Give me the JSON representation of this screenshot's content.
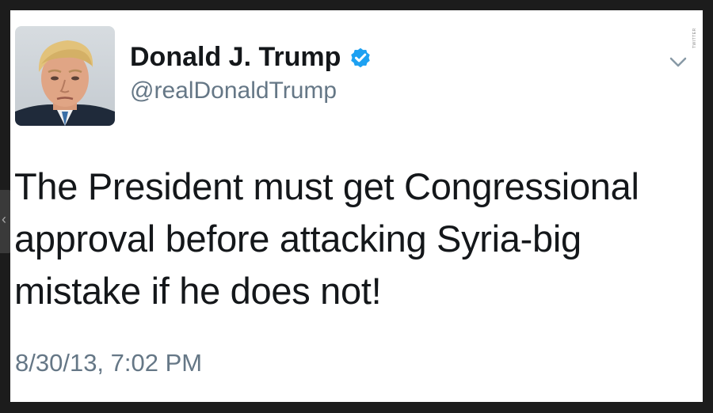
{
  "tweet": {
    "author_name": "Donald J. Trump",
    "handle": "@realDonaldTrump",
    "text": "The President must get Congressional approval before attacking Syria-big mistake if he does not!",
    "timestamp": "8/30/13, 7:02 PM",
    "verified_icon": "verified-badge-icon",
    "menu_icon": "chevron-down-icon"
  },
  "watermark": {
    "text": "TWITTER"
  },
  "side_nav": {
    "icon": "chevron-left-icon",
    "glyph": "‹"
  },
  "colors": {
    "verified_blue": "#1da1f2",
    "secondary_text": "#657786",
    "primary_text": "#14171a"
  }
}
